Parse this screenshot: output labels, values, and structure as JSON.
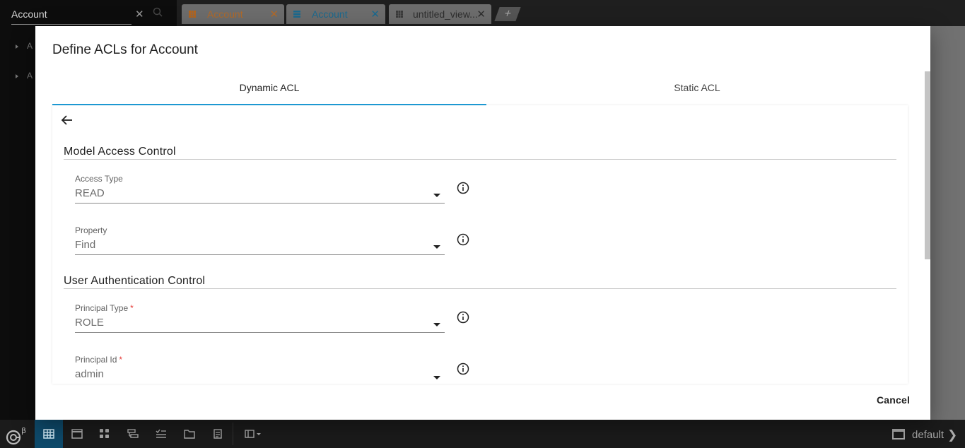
{
  "sidebar": {
    "search_value": "Account",
    "items": [
      "A",
      "A"
    ]
  },
  "tabs": [
    {
      "label": "Account",
      "color": "#e0832a",
      "icon": "grid-icon"
    },
    {
      "label": "Account",
      "color": "#1e9ed9",
      "icon": "list-icon"
    },
    {
      "label": "untitled_view...",
      "color": "#e8e8e8",
      "icon": "grid-icon"
    }
  ],
  "add_tab_label": "+",
  "modal": {
    "title": "Define ACLs for Account",
    "tabs": [
      {
        "label": "Dynamic ACL",
        "active": true
      },
      {
        "label": "Static ACL",
        "active": false
      }
    ],
    "sections": [
      {
        "title": "Model Access Control",
        "fields": [
          {
            "label": "Access Type",
            "value": "READ",
            "required": false
          },
          {
            "label": "Property",
            "value": "Find",
            "required": false
          }
        ]
      },
      {
        "title": "User Authentication Control",
        "fields": [
          {
            "label": "Principal Type",
            "value": "ROLE",
            "required": true
          },
          {
            "label": "Principal Id",
            "value": "admin",
            "required": true
          }
        ]
      }
    ],
    "required_marker": "*",
    "cancel_label": "Cancel"
  },
  "bottom_bar": {
    "logo_superscript": "β",
    "workspace_label": "default"
  },
  "colors": {
    "accent": "#1e9ed9",
    "account_tab": "#e0832a",
    "required": "#e53935",
    "active_bottom_button": "#0e4a6b"
  }
}
